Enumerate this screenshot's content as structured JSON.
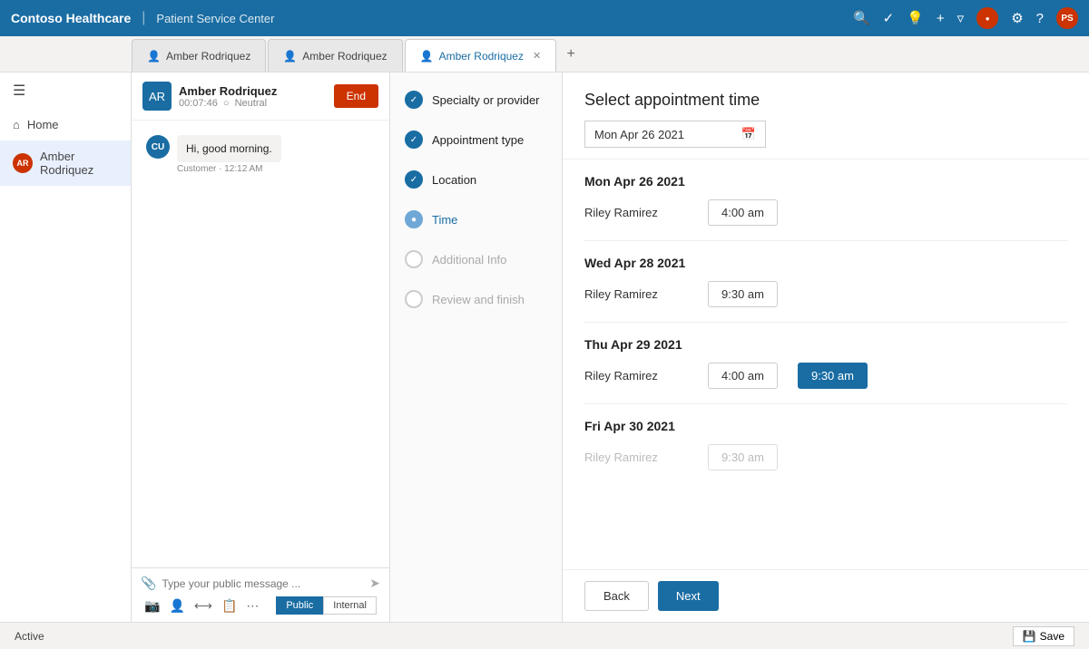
{
  "topbar": {
    "brand": "Contoso Healthcare",
    "divider": "|",
    "subtitle": "Patient Service Center",
    "icons": [
      "search",
      "checkmark",
      "lightbulb",
      "plus",
      "filter"
    ],
    "notification_dot": "red",
    "settings_icon": "gear",
    "help_icon": "question",
    "user_initials": "PS"
  },
  "tabs": [
    {
      "id": "tab1",
      "label": "Amber Rodriquez",
      "icon": "person",
      "active": false,
      "closable": false
    },
    {
      "id": "tab2",
      "label": "Amber Rodriquez",
      "icon": "person",
      "active": false,
      "closable": false
    },
    {
      "id": "tab3",
      "label": "Amber Rodriquez",
      "icon": "person",
      "active": true,
      "closable": true
    }
  ],
  "sidebar": {
    "home_label": "Home",
    "contact_name": "Amber Rodriquez"
  },
  "chat": {
    "agent_initials": "AR",
    "contact_name": "Amber Rodriquez",
    "timer": "00:07:46",
    "sentiment": "Neutral",
    "end_button": "End",
    "message_avatar": "CU",
    "message_text": "Hi, good morning.",
    "message_meta": "Customer · 12:12 AM",
    "input_placeholder": "Type your public message ...",
    "mode_public": "Public",
    "mode_internal": "Internal"
  },
  "wizard": {
    "steps": [
      {
        "id": "specialty",
        "label": "Specialty or provider",
        "state": "completed"
      },
      {
        "id": "appointment_type",
        "label": "Appointment type",
        "state": "completed"
      },
      {
        "id": "location",
        "label": "Location",
        "state": "completed"
      },
      {
        "id": "time",
        "label": "Time",
        "state": "active"
      },
      {
        "id": "additional_info",
        "label": "Additional Info",
        "state": "inactive"
      },
      {
        "id": "review",
        "label": "Review and finish",
        "state": "inactive"
      }
    ]
  },
  "appointment": {
    "title": "Select appointment time",
    "date_value": "Mon Apr 26 2021",
    "days": [
      {
        "label": "Mon Apr 26 2021",
        "providers": [
          {
            "name": "Riley Ramirez",
            "slots": [
              {
                "time": "4:00 am",
                "selected": false
              }
            ]
          }
        ]
      },
      {
        "label": "Wed Apr 28 2021",
        "providers": [
          {
            "name": "Riley Ramirez",
            "slots": [
              {
                "time": "9:30 am",
                "selected": false
              }
            ]
          }
        ]
      },
      {
        "label": "Thu Apr 29 2021",
        "providers": [
          {
            "name": "Riley Ramirez",
            "slots": [
              {
                "time": "4:00 am",
                "selected": false
              },
              {
                "time": "9:30 am",
                "selected": true
              }
            ]
          }
        ]
      },
      {
        "label": "Fri Apr 30 2021",
        "providers": [
          {
            "name": "Riley Ramirez",
            "slots": [
              {
                "time": "9:30 am",
                "selected": false
              }
            ]
          }
        ]
      }
    ],
    "back_label": "Back",
    "next_label": "Next"
  },
  "statusbar": {
    "status": "Active",
    "save_label": "Save"
  }
}
